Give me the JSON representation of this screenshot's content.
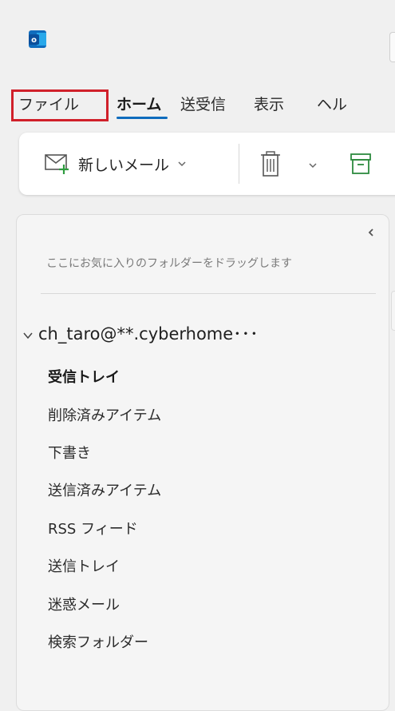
{
  "colors": {
    "accent": "#0f6cbd",
    "highlight_border": "#d0202a",
    "background": "#f0f0f0"
  },
  "app": {
    "icon": "outlook-icon",
    "icon_letter": "o"
  },
  "menu_tabs": [
    {
      "label": "ファイル",
      "highlighted": true
    },
    {
      "label": "ホーム",
      "active": true
    },
    {
      "label": "送受信"
    },
    {
      "label": "表示"
    },
    {
      "label": "ヘル"
    }
  ],
  "ribbon": {
    "new_mail_label": "新しいメール",
    "new_mail_icon": "new-mail-icon",
    "delete_icon": "trash-icon",
    "archive_icon": "archive-icon"
  },
  "folder_pane": {
    "favorites_hint": "ここにお気に入りのフォルダーをドラッグします",
    "account_name": "ch_taro@**.cyberhome･･･",
    "folders": [
      {
        "label": "受信トレイ",
        "selected": true
      },
      {
        "label": "削除済みアイテム"
      },
      {
        "label": "下書き"
      },
      {
        "label": "送信済みアイテム"
      },
      {
        "label": "RSS フィード"
      },
      {
        "label": "送信トレイ"
      },
      {
        "label": "迷惑メール"
      },
      {
        "label": "検索フォルダー"
      }
    ]
  }
}
